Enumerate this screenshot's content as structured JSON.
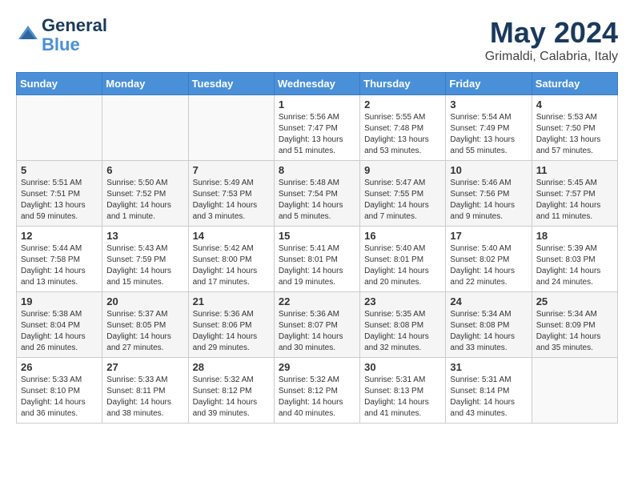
{
  "header": {
    "logo_line1": "General",
    "logo_line2": "Blue",
    "month": "May 2024",
    "location": "Grimaldi, Calabria, Italy"
  },
  "weekdays": [
    "Sunday",
    "Monday",
    "Tuesday",
    "Wednesday",
    "Thursday",
    "Friday",
    "Saturday"
  ],
  "weeks": [
    [
      {
        "day": "",
        "sunrise": "",
        "sunset": "",
        "daylight": ""
      },
      {
        "day": "",
        "sunrise": "",
        "sunset": "",
        "daylight": ""
      },
      {
        "day": "",
        "sunrise": "",
        "sunset": "",
        "daylight": ""
      },
      {
        "day": "1",
        "sunrise": "5:56 AM",
        "sunset": "7:47 PM",
        "daylight": "13 hours and 51 minutes."
      },
      {
        "day": "2",
        "sunrise": "5:55 AM",
        "sunset": "7:48 PM",
        "daylight": "13 hours and 53 minutes."
      },
      {
        "day": "3",
        "sunrise": "5:54 AM",
        "sunset": "7:49 PM",
        "daylight": "13 hours and 55 minutes."
      },
      {
        "day": "4",
        "sunrise": "5:53 AM",
        "sunset": "7:50 PM",
        "daylight": "13 hours and 57 minutes."
      }
    ],
    [
      {
        "day": "5",
        "sunrise": "5:51 AM",
        "sunset": "7:51 PM",
        "daylight": "13 hours and 59 minutes."
      },
      {
        "day": "6",
        "sunrise": "5:50 AM",
        "sunset": "7:52 PM",
        "daylight": "14 hours and 1 minute."
      },
      {
        "day": "7",
        "sunrise": "5:49 AM",
        "sunset": "7:53 PM",
        "daylight": "14 hours and 3 minutes."
      },
      {
        "day": "8",
        "sunrise": "5:48 AM",
        "sunset": "7:54 PM",
        "daylight": "14 hours and 5 minutes."
      },
      {
        "day": "9",
        "sunrise": "5:47 AM",
        "sunset": "7:55 PM",
        "daylight": "14 hours and 7 minutes."
      },
      {
        "day": "10",
        "sunrise": "5:46 AM",
        "sunset": "7:56 PM",
        "daylight": "14 hours and 9 minutes."
      },
      {
        "day": "11",
        "sunrise": "5:45 AM",
        "sunset": "7:57 PM",
        "daylight": "14 hours and 11 minutes."
      }
    ],
    [
      {
        "day": "12",
        "sunrise": "5:44 AM",
        "sunset": "7:58 PM",
        "daylight": "14 hours and 13 minutes."
      },
      {
        "day": "13",
        "sunrise": "5:43 AM",
        "sunset": "7:59 PM",
        "daylight": "14 hours and 15 minutes."
      },
      {
        "day": "14",
        "sunrise": "5:42 AM",
        "sunset": "8:00 PM",
        "daylight": "14 hours and 17 minutes."
      },
      {
        "day": "15",
        "sunrise": "5:41 AM",
        "sunset": "8:01 PM",
        "daylight": "14 hours and 19 minutes."
      },
      {
        "day": "16",
        "sunrise": "5:40 AM",
        "sunset": "8:01 PM",
        "daylight": "14 hours and 20 minutes."
      },
      {
        "day": "17",
        "sunrise": "5:40 AM",
        "sunset": "8:02 PM",
        "daylight": "14 hours and 22 minutes."
      },
      {
        "day": "18",
        "sunrise": "5:39 AM",
        "sunset": "8:03 PM",
        "daylight": "14 hours and 24 minutes."
      }
    ],
    [
      {
        "day": "19",
        "sunrise": "5:38 AM",
        "sunset": "8:04 PM",
        "daylight": "14 hours and 26 minutes."
      },
      {
        "day": "20",
        "sunrise": "5:37 AM",
        "sunset": "8:05 PM",
        "daylight": "14 hours and 27 minutes."
      },
      {
        "day": "21",
        "sunrise": "5:36 AM",
        "sunset": "8:06 PM",
        "daylight": "14 hours and 29 minutes."
      },
      {
        "day": "22",
        "sunrise": "5:36 AM",
        "sunset": "8:07 PM",
        "daylight": "14 hours and 30 minutes."
      },
      {
        "day": "23",
        "sunrise": "5:35 AM",
        "sunset": "8:08 PM",
        "daylight": "14 hours and 32 minutes."
      },
      {
        "day": "24",
        "sunrise": "5:34 AM",
        "sunset": "8:08 PM",
        "daylight": "14 hours and 33 minutes."
      },
      {
        "day": "25",
        "sunrise": "5:34 AM",
        "sunset": "8:09 PM",
        "daylight": "14 hours and 35 minutes."
      }
    ],
    [
      {
        "day": "26",
        "sunrise": "5:33 AM",
        "sunset": "8:10 PM",
        "daylight": "14 hours and 36 minutes."
      },
      {
        "day": "27",
        "sunrise": "5:33 AM",
        "sunset": "8:11 PM",
        "daylight": "14 hours and 38 minutes."
      },
      {
        "day": "28",
        "sunrise": "5:32 AM",
        "sunset": "8:12 PM",
        "daylight": "14 hours and 39 minutes."
      },
      {
        "day": "29",
        "sunrise": "5:32 AM",
        "sunset": "8:12 PM",
        "daylight": "14 hours and 40 minutes."
      },
      {
        "day": "30",
        "sunrise": "5:31 AM",
        "sunset": "8:13 PM",
        "daylight": "14 hours and 41 minutes."
      },
      {
        "day": "31",
        "sunrise": "5:31 AM",
        "sunset": "8:14 PM",
        "daylight": "14 hours and 43 minutes."
      },
      {
        "day": "",
        "sunrise": "",
        "sunset": "",
        "daylight": ""
      }
    ]
  ]
}
